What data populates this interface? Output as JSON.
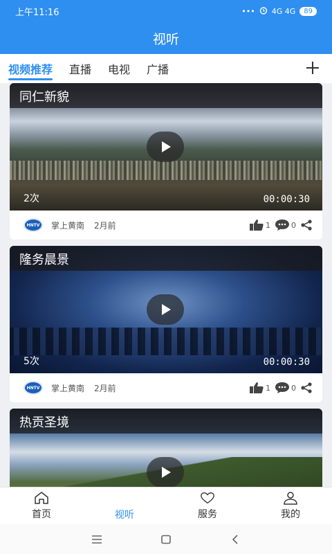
{
  "status": {
    "time": "上午11:16",
    "dots": "•••",
    "network": "4G 4G",
    "battery": "89"
  },
  "header": {
    "title": "视听"
  },
  "tabs": [
    {
      "label": "视频推荐"
    },
    {
      "label": "直播"
    },
    {
      "label": "电视"
    },
    {
      "label": "广播"
    }
  ],
  "cards": [
    {
      "title": "同仁新貌",
      "views": "2次",
      "duration": "00:00:30",
      "source": "掌上黄南",
      "time": "2月前",
      "likes": "1",
      "comments": "0"
    },
    {
      "title": "隆务晨景",
      "views": "5次",
      "duration": "00:00:30",
      "source": "掌上黄南",
      "time": "2月前",
      "likes": "1",
      "comments": "0"
    },
    {
      "title": "热贡圣境"
    }
  ],
  "logo_text": "HNTV",
  "bottom_nav": [
    {
      "label": "首页",
      "icon": "home-icon"
    },
    {
      "label": "视听",
      "icon": ""
    },
    {
      "label": "服务",
      "icon": "heart-icon"
    },
    {
      "label": "我的",
      "icon": "user-icon"
    }
  ],
  "colors": {
    "primary": "#2e8ff0"
  }
}
